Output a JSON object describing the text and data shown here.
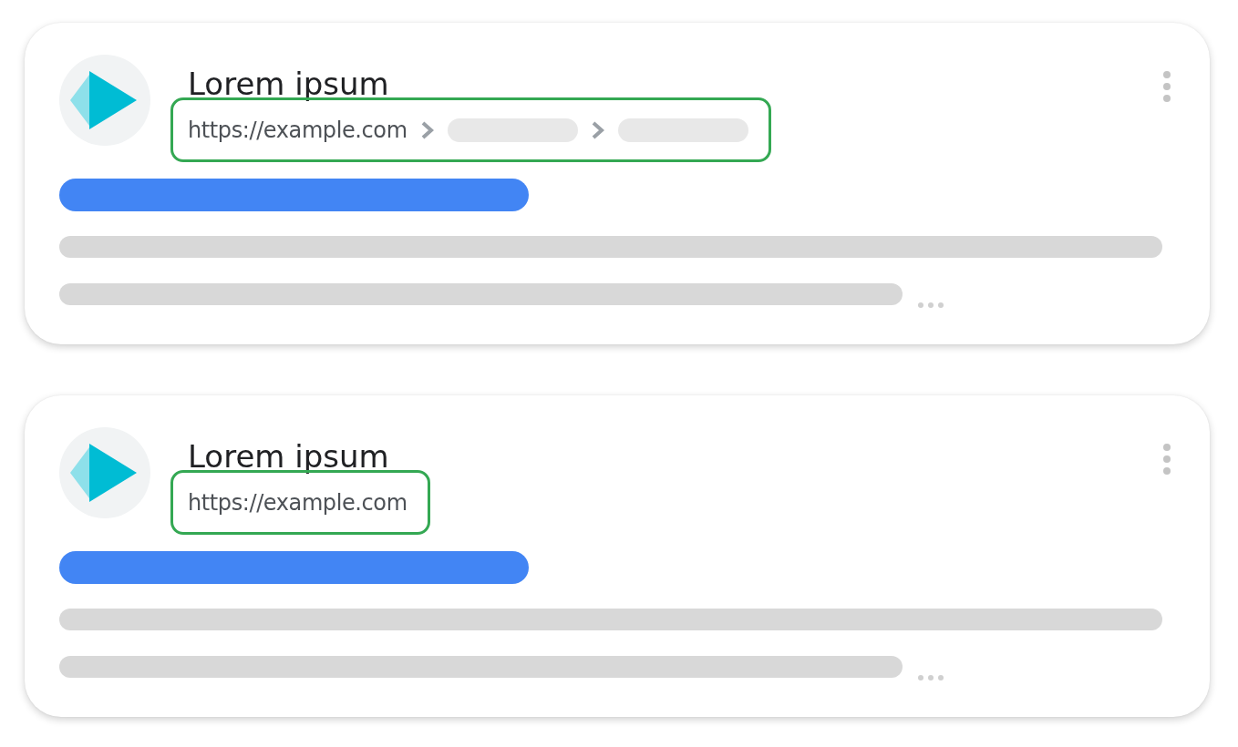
{
  "results": [
    {
      "title": "Lorem ipsum",
      "url": "https://example.com",
      "url_highlighted": true,
      "breadcrumbs": [
        {
          "kind": "placeholder"
        },
        {
          "kind": "placeholder"
        }
      ]
    },
    {
      "title": "Lorem ipsum",
      "url": "https://example.com",
      "url_highlighted": true
    }
  ]
}
